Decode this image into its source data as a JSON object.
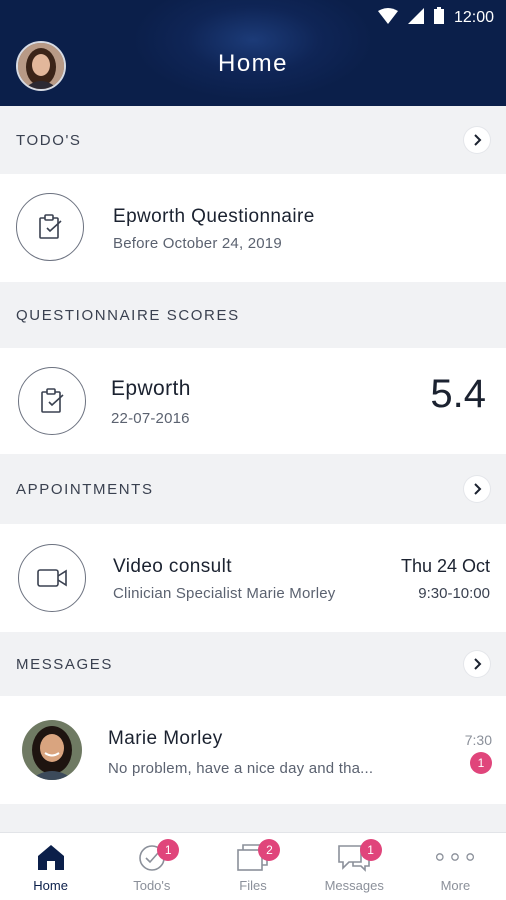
{
  "status_bar": {
    "time": "12:00",
    "icons": [
      "wifi-icon",
      "signal-icon",
      "battery-icon"
    ]
  },
  "header": {
    "title": "Home",
    "avatar": "user-avatar"
  },
  "todos": {
    "section_label": "TODO'S",
    "item": {
      "title": "Epworth Questionnaire",
      "subtitle": "Before October 24, 2019",
      "icon": "clipboard-icon"
    }
  },
  "scores": {
    "section_label": "QUESTIONNAIRE SCORES",
    "item": {
      "title": "Epworth",
      "date": "22-07-2016",
      "score": "5.4",
      "icon": "clipboard-icon"
    }
  },
  "appointments": {
    "section_label": "APPOINTMENTS",
    "item": {
      "title": "Video consult",
      "subtitle": "Clinician Specialist Marie Morley",
      "date": "Thu 24 Oct",
      "time": "9:30-10:00",
      "icon": "video-camera-icon"
    }
  },
  "messages": {
    "section_label": "MESSAGES",
    "item": {
      "sender": "Marie Morley",
      "preview": "No problem, have a nice day and tha...",
      "time": "7:30",
      "unread": "1"
    }
  },
  "tabbar": {
    "tabs": [
      {
        "label": "Home",
        "icon": "home-icon",
        "badge": ""
      },
      {
        "label": "Todo's",
        "icon": "check-circle-icon",
        "badge": "1"
      },
      {
        "label": "Files",
        "icon": "files-icon",
        "badge": "2"
      },
      {
        "label": "Messages",
        "icon": "chat-icon",
        "badge": "1"
      },
      {
        "label": "More",
        "icon": "more-dots-icon",
        "badge": ""
      }
    ]
  },
  "colors": {
    "header": "#0f2556",
    "accent_badge": "#e0457b",
    "background": "#f1f2f4"
  }
}
